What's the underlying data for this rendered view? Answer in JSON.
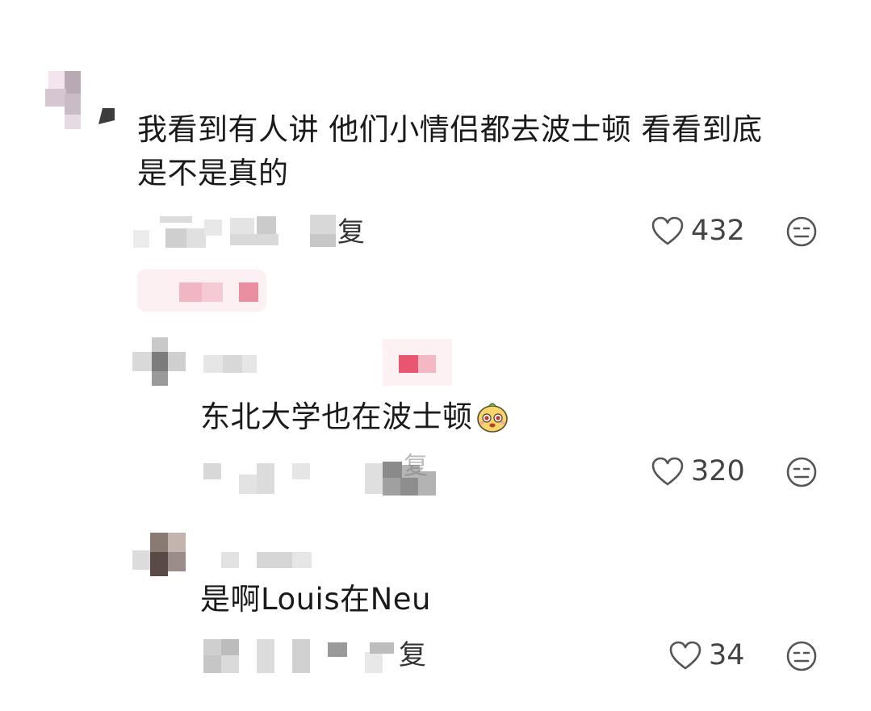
{
  "comments": [
    {
      "text_line1": "我看到有人讲 他们小情侣都去波士顿 看看到底",
      "text_line2": "是不是真的",
      "reply_fragment": "复",
      "likes": "432"
    },
    {
      "text": "东北大学也在波士顿",
      "emoji": "emoji-face",
      "reply_fragment": "复",
      "likes": "320"
    },
    {
      "text": "是啊Louis在Neu",
      "reply_fragment": "复",
      "likes": "34"
    }
  ],
  "colors": {
    "text": "#1a1a1a",
    "icon": "#444444",
    "blur_pink": "#e85a74"
  },
  "icons": [
    "heart-outline-icon",
    "dislike-face-icon"
  ]
}
